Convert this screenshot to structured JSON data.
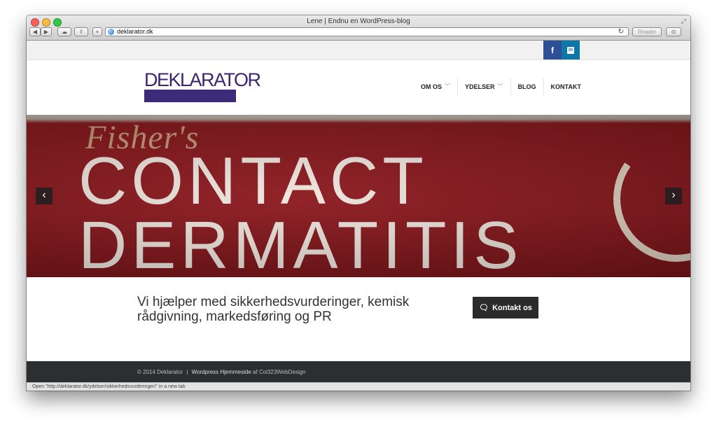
{
  "window": {
    "title": "Lene | Endnu en WordPress-blog"
  },
  "toolbar": {
    "url": "deklarator.dk",
    "reader_label": "Reader"
  },
  "social": {
    "facebook_label": "f",
    "linkedin_label": "in"
  },
  "header": {
    "logo_text": "DEKLARATOR",
    "nav": [
      {
        "label": "OM OS",
        "has_dropdown": true
      },
      {
        "label": "YDELSER",
        "has_dropdown": true
      },
      {
        "label": "BLOG",
        "has_dropdown": false
      },
      {
        "label": "KONTAKT",
        "has_dropdown": false
      }
    ]
  },
  "slider": {
    "image_text_1": "Fisher's",
    "image_text_2": "CONTACT",
    "image_text_3": "DERMATITIS",
    "prev_label": "‹",
    "next_label": "›"
  },
  "cta": {
    "tagline": "Vi hjælper med sikkerhedsvurderinger, kemisk rådgivning, markedsføring og PR",
    "button_label": "Kontakt os"
  },
  "footer": {
    "copyright": "© 2014 Deklarator",
    "separator": "|",
    "credit_link": "Wordpress Hjemmeside",
    "credit_by": "af Col323WebDesign"
  },
  "statusbar": {
    "text": "Open \"http://deklarator.dk/ydelser/sikkerhedsvurderinger/\" in a new tab"
  }
}
